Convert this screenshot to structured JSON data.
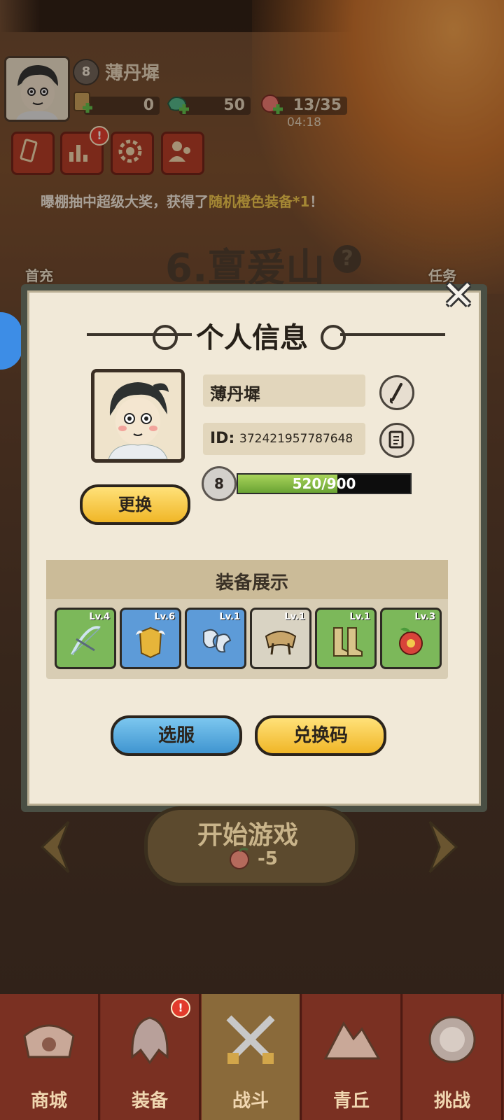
{
  "header": {
    "player_level": "8",
    "player_name": "薄丹墀",
    "resource_1": "0",
    "resource_2": "50",
    "stamina": "13/35",
    "stamina_timer": "04:18"
  },
  "broadcast": {
    "prefix": "曝棚抽中超级大奖，获得了",
    "highlight": "随机橙色装备*1",
    "suffix": "！"
  },
  "stage": {
    "title": "6.亶爰山",
    "left_label": "首充",
    "right_label": "任务"
  },
  "profile_modal": {
    "title": "个人信息",
    "name": "薄丹墀",
    "id_label": "ID:",
    "id_value": "372421957787648",
    "level": "8",
    "xp_text": "520/900",
    "xp_fraction": 0.578,
    "change_avatar_label": "更换",
    "equipment_title": "装备展示",
    "equipment": [
      {
        "level": "Lv.4",
        "rarity": "green",
        "icon": "bow-icon"
      },
      {
        "level": "Lv.6",
        "rarity": "blue",
        "icon": "golden-armor-icon"
      },
      {
        "level": "Lv.1",
        "rarity": "blue",
        "icon": "bracer-icon"
      },
      {
        "level": "Lv.1",
        "rarity": "gray",
        "icon": "shoulder-pad-icon"
      },
      {
        "level": "Lv.1",
        "rarity": "green",
        "icon": "boots-icon"
      },
      {
        "level": "Lv.3",
        "rarity": "green",
        "icon": "fruit-amulet-icon"
      }
    ],
    "select_server_label": "选服",
    "redeem_code_label": "兑换码"
  },
  "start_game": {
    "label": "开始游戏",
    "cost": "-5"
  },
  "bottom_nav": [
    {
      "label": "商城",
      "icon": "shop-icon"
    },
    {
      "label": "装备",
      "icon": "helmet-icon"
    },
    {
      "label": "战斗",
      "icon": "crossed-swords-icon"
    },
    {
      "label": "青丘",
      "icon": "mountain-icon"
    },
    {
      "label": "挑战",
      "icon": "orb-icon"
    }
  ],
  "colors": {
    "accent_yellow": "#f0b627",
    "accent_blue": "#3f95d0",
    "xp_green": "#6aa334",
    "highlight_text": "#f2c94c"
  }
}
